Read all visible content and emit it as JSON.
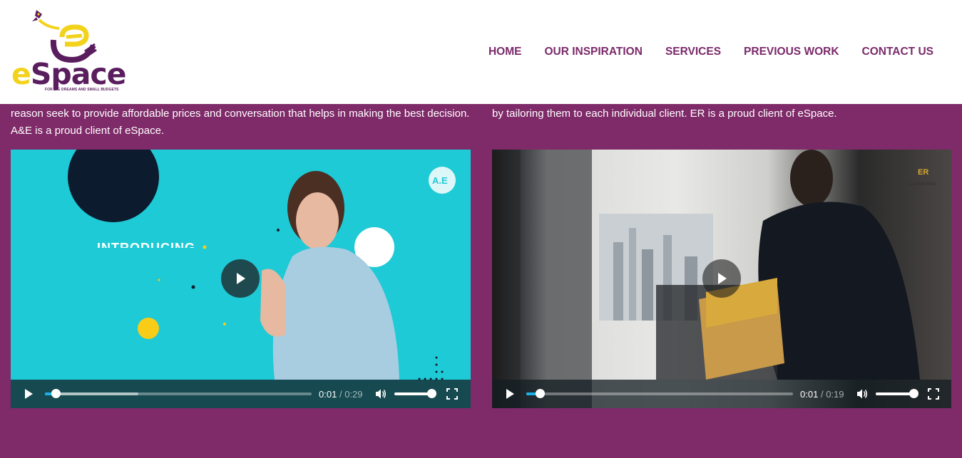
{
  "brand": {
    "name_e": "e",
    "name_rest": "Space",
    "tagline": "FOR BIG DREAMS AND SMALL BUDGETS"
  },
  "nav": {
    "items": [
      "HOME",
      "OUR INSPIRATION",
      "SERVICES",
      "PREVIOUS WORK",
      "CONTACT US"
    ]
  },
  "colors": {
    "page_background": "#7f2a69",
    "nav_text": "#7b2a6b",
    "progress_played": "#1aafe6",
    "logo_yellow": "#f3d21c",
    "logo_purple": "#5a1d5e"
  },
  "clients": [
    {
      "description": "reason seek to provide affordable prices and conversation that helps in making the best decision. A&E is a proud client of eSpace.",
      "video": {
        "overlay_text": "INTRODUCING",
        "corner_logo": "A.E",
        "current_time": "0:01",
        "separator": "/",
        "duration": "0:29",
        "progress_fraction": 0.04,
        "buffered_fraction": 0.35,
        "volume_fraction": 0.9
      }
    },
    {
      "description": "by tailoring them to each individual client. ER is a proud client of eSpace.",
      "video": {
        "corner_logo": "ER",
        "corner_logo_caption": "ELEANOR ROSS",
        "current_time": "0:01",
        "separator": "/",
        "duration": "0:19",
        "progress_fraction": 0.05,
        "buffered_fraction": 0.05,
        "volume_fraction": 0.92
      }
    }
  ],
  "icons": {
    "play": "play-icon",
    "volume": "volume-icon",
    "fullscreen": "fullscreen-icon",
    "rocket": "rocket-icon"
  }
}
